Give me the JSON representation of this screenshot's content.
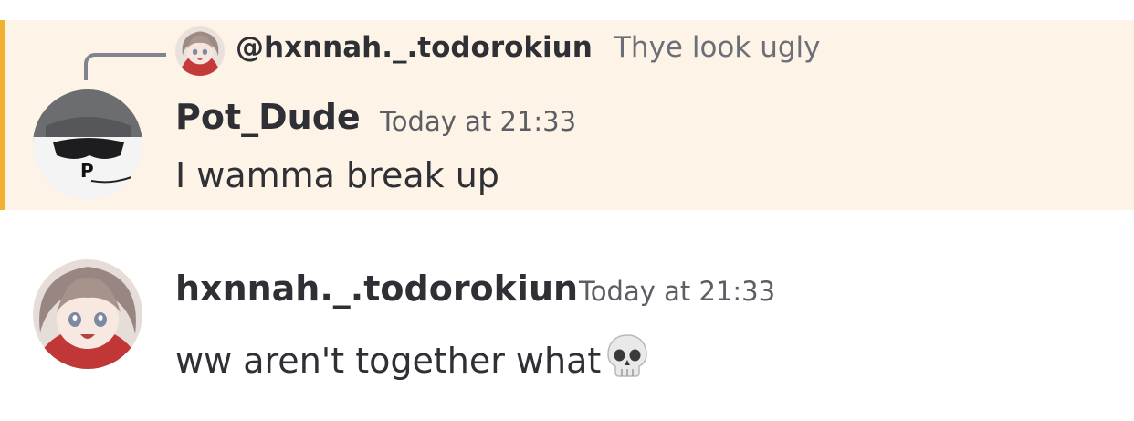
{
  "messages": [
    {
      "highlighted": true,
      "reply": {
        "author": "@hxnnah._.todorokiun",
        "text": "Thye look ugly",
        "avatar_icon": "anime-girl-avatar"
      },
      "author": "Pot_Dude",
      "timestamp": "Today at 21:33",
      "content": "I wamma break up",
      "avatar_icon": "sunglasses-cap-avatar"
    },
    {
      "highlighted": false,
      "author": "hxnnah._.todorokiun",
      "timestamp": "Today at 21:33",
      "content": "ww aren't together what",
      "emoji": "skull",
      "avatar_icon": "anime-girl-avatar"
    }
  ],
  "colors": {
    "highlight_bg": "#fdf4e7",
    "highlight_bar": "#f0b132",
    "author": "#2e3035",
    "timestamp": "#5c5e66"
  }
}
